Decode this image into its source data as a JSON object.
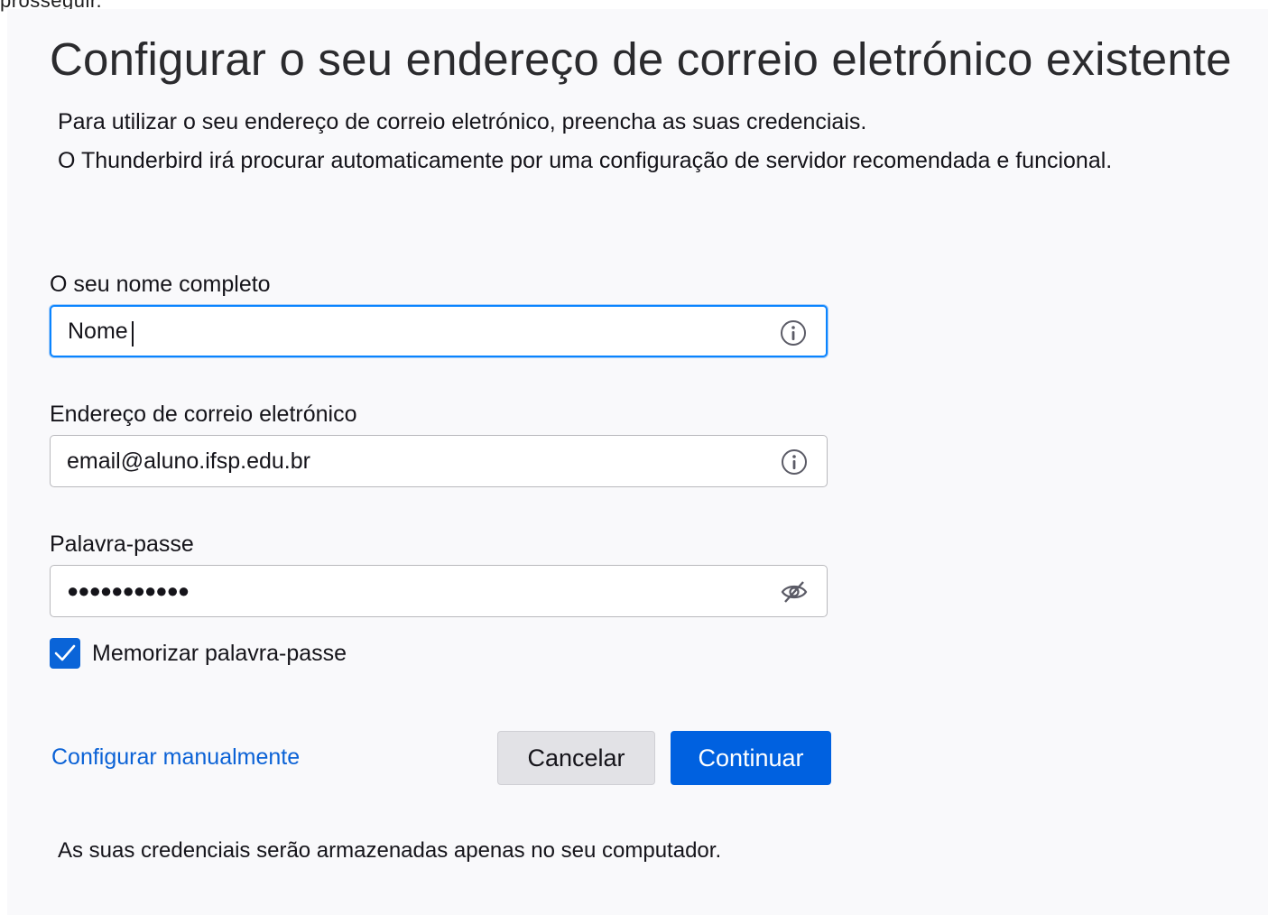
{
  "top_fragment": "prosseguir.",
  "title": "Configurar o seu endereço de correio eletrónico existente",
  "intro": [
    "Para utilizar o seu endereço de correio eletrónico, preencha as suas credenciais.",
    "O Thunderbird irá procurar automaticamente por uma configuração de servidor recomendada e funcional."
  ],
  "fields": {
    "name": {
      "label": "O seu nome completo",
      "value": "Nome",
      "focused": true,
      "icon": "info-icon"
    },
    "email": {
      "label": "Endereço de correio eletrónico",
      "value": "email@aluno.ifsp.edu.br",
      "icon": "info-icon"
    },
    "password": {
      "label": "Palavra-passe",
      "value": "●●●●●●●●●●●",
      "icon": "eye-slash-icon"
    }
  },
  "remember_password": {
    "label": "Memorizar palavra-passe",
    "checked": true
  },
  "manual_config_link": "Configurar manualmente",
  "buttons": {
    "cancel": "Cancelar",
    "continue": "Continuar"
  },
  "footnote": "As suas credenciais serão armazenadas apenas no seu computador.",
  "colors": {
    "accent": "#0061e0",
    "link": "#0b62d6",
    "focus_ring": "#0a84ff",
    "panel_bg": "#f9f9fb"
  }
}
